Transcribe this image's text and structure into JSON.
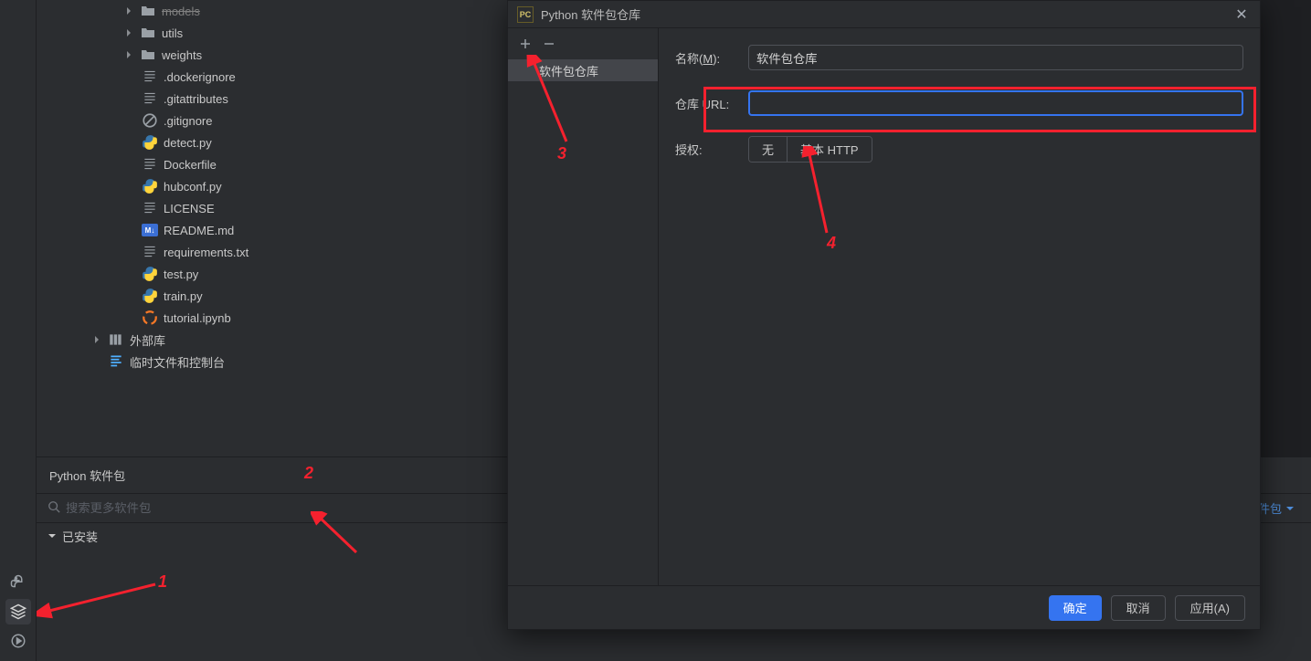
{
  "tree": {
    "models": "models",
    "utils": "utils",
    "weights": "weights",
    "dockerignore": ".dockerignore",
    "gitattributes": ".gitattributes",
    "gitignore": ".gitignore",
    "detect": "detect.py",
    "dockerfile": "Dockerfile",
    "hubconf": "hubconf.py",
    "license": "LICENSE",
    "readme": "README.md",
    "requirements": "requirements.txt",
    "test": "test.py",
    "train": "train.py",
    "tutorial": "tutorial.ipynb",
    "external_libs": "外部库",
    "scratches": "临时文件和控制台"
  },
  "bottom_panel": {
    "title": "Python 软件包",
    "search_placeholder": "搜索更多软件包",
    "add_package": "添加软件包",
    "installed": "已安装"
  },
  "dialog": {
    "badge": "PC",
    "title": "Python 软件包仓库",
    "list_item": "软件包仓库",
    "name_label_pre": "名称(",
    "name_label_mn": "M",
    "name_label_post": "):",
    "name_value": "软件包仓库",
    "url_label": "仓库 URL:",
    "url_value": "",
    "auth_label": "授权:",
    "auth_none": "无",
    "auth_basic": "基本 HTTP",
    "ok": "确定",
    "cancel": "取消",
    "apply": "应用(A)"
  },
  "annotations": {
    "n1": "1",
    "n2": "2",
    "n3": "3",
    "n4": "4"
  }
}
